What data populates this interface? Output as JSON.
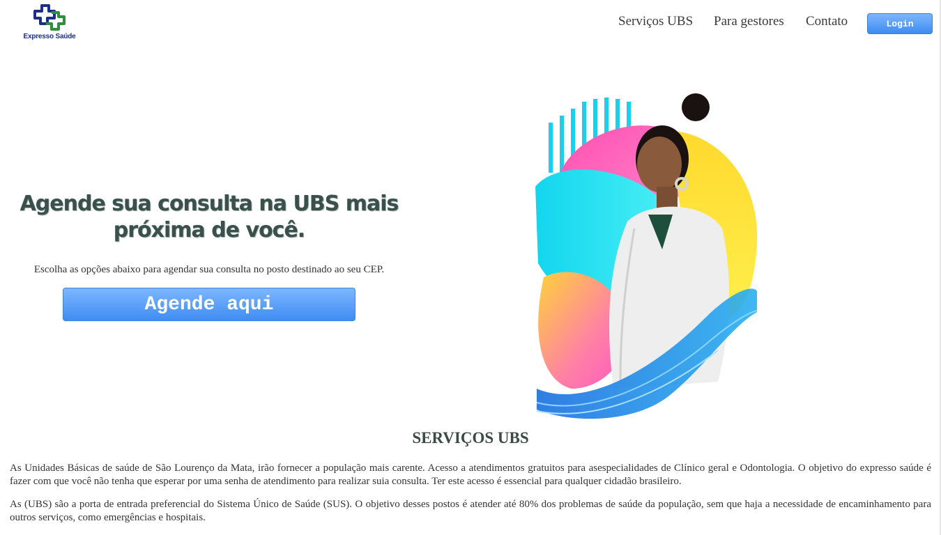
{
  "header": {
    "logo_text": "Expresso Saúde",
    "nav": [
      "Serviços UBS",
      "Para gestores",
      "Contato"
    ],
    "login_label": "Login"
  },
  "hero": {
    "title": "Agende sua consulta na UBS mais próxima de você.",
    "subtitle": "Escolha as opções abaixo para agendar sua consulta no posto destinado ao seu CEP.",
    "cta_label": "Agende aqui"
  },
  "section": {
    "title": "SERVIÇOS UBS",
    "paragraphs": [
      "As Unidades Básicas de saúde de São Lourenço da Mata, irão fornecer a população mais carente. Acesso a atendimentos gratuitos para asespecialidades de Clínico geral e Odontologia. O objetivo do expresso saúde é fazer com que você não tenha que esperar por uma senha de atendimento para realizar suia consulta. Ter este acesso é essencial para qualquer cidadão brasileiro.",
      "As (UBS) são a porta de entrada preferencial do Sistema Único de Saúde (SUS). O objetivo desses postos é atender até 80% dos problemas de saúde da população, sem que haja a necessidade de encaminhamento para outros serviços, como emergências e hospitais."
    ]
  },
  "colors": {
    "logo_blue": "#1b2f86",
    "logo_green": "#2f8f3f",
    "button_blue": "#4a90f0",
    "title_dark": "#39504b"
  },
  "icons": {
    "logo": "medical-cross-logo",
    "illustration": "doctor-woman-colorful-illustration"
  }
}
